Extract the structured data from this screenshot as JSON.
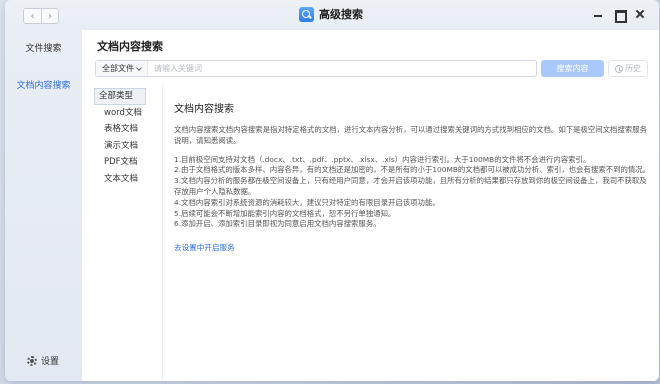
{
  "titlebar": {
    "app_title": "高级搜索",
    "back_icon": "‹",
    "forward_icon": "›"
  },
  "sidebar": {
    "items": [
      {
        "label": "文件搜索",
        "active": false
      },
      {
        "label": "文档内容搜索",
        "active": true
      }
    ],
    "settings_label": "设置"
  },
  "main": {
    "title": "文档内容搜索",
    "search": {
      "scope_label": "全部文件",
      "placeholder": "请输入关键词",
      "search_button": "搜索内容",
      "history_button": "历史"
    },
    "types": [
      {
        "label": "全部类型",
        "active": true
      },
      {
        "label": "word文档",
        "active": false
      },
      {
        "label": "表格文档",
        "active": false
      },
      {
        "label": "演示文档",
        "active": false
      },
      {
        "label": "PDF文档",
        "active": false
      },
      {
        "label": "文本文档",
        "active": false
      }
    ],
    "content": {
      "title": "文档内容搜索",
      "intro": "文档内容搜索文档内容搜索是指对特定格式的文档，进行文本内容分析，可以通过搜索关键词的方式找到相应的文档。如下是极空间文档搜索服务说明，请知悉阅读。",
      "notes": [
        "1.目前极空间支持对文档（.docx、.txt、.pdf、.pptx、.xlsx、.xls）内容进行索引。大于100MB的文件将不会进行内容索引。",
        "2.由于文档格式的版本多样、内容各异，有的文档还是加密的，不是所有的小于100MB的文档都可以被成功分析、索引，也会有搜索不到的情况。",
        "3.文档内容分析的服务都在极空间设备上，只有经用户同意，才会开启该项功能，且所有分析的结果都只存放到你的极空间设备上，我司不获取及存放用户个人隐私数据。",
        "4.文档内容索引对系统资源的消耗较大，建议只对特定的有限目录开启该项功能。",
        "5.后续可能会不断增加能索引内容的文档格式，恕不另行单独通知。",
        "6.添加开启、添加索引目录即视为同意启用文档内容搜索服务。"
      ],
      "link": "去设置中开启服务"
    }
  },
  "colors": {
    "accent": "#2b6fdc",
    "search_button_bg": "#a9c8fb",
    "sidebar_bg": "#e6ebf3"
  }
}
